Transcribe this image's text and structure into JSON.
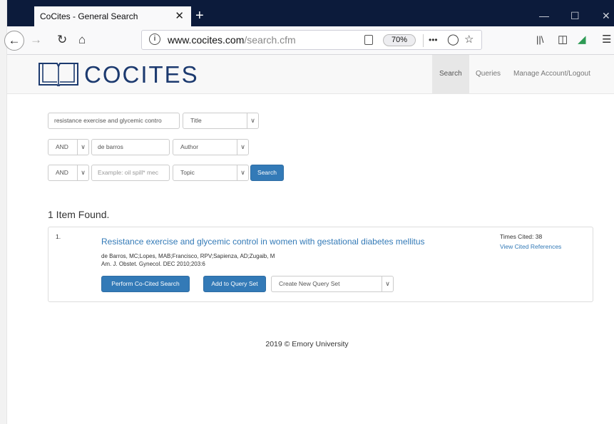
{
  "browser": {
    "tab_title": "CoCites - General Search",
    "tab_close": "✕",
    "new_tab": "+",
    "url_domain": "www.cocites.com",
    "url_path": "/search.cfm",
    "zoom": "70%",
    "page_actions": "•••"
  },
  "site": {
    "logo_text": "COCITES",
    "nav": [
      "Search",
      "Queries",
      "Manage Account/Logout"
    ]
  },
  "search": {
    "row1": {
      "value": "resistance exercise and glycemic contro",
      "field": "Title"
    },
    "row2": {
      "op": "AND",
      "value": "de barros",
      "field": "Author"
    },
    "row3": {
      "op": "AND",
      "placeholder": "Example: oil spill* mec",
      "field": "Topic"
    },
    "button": "Search"
  },
  "results": {
    "count_text": "1 Item Found.",
    "items": [
      {
        "number": "1.",
        "title": "Resistance exercise and glycemic control in women with gestational diabetes mellitus",
        "authors": "de Barros, MC;Lopes, MAB;Francisco, RPV;Sapienza, AD;Zugaib, M",
        "source": "Am. J. Obstet. Gynecol. DEC 2010;203:6",
        "times_cited": "Times Cited: 38",
        "view_refs": "View Cited References",
        "btn_cocited": "Perform Co-Cited Search",
        "btn_add": "Add to Query Set",
        "query_set": "Create New Query Set"
      }
    ]
  },
  "footer": "2019 © Emory University"
}
